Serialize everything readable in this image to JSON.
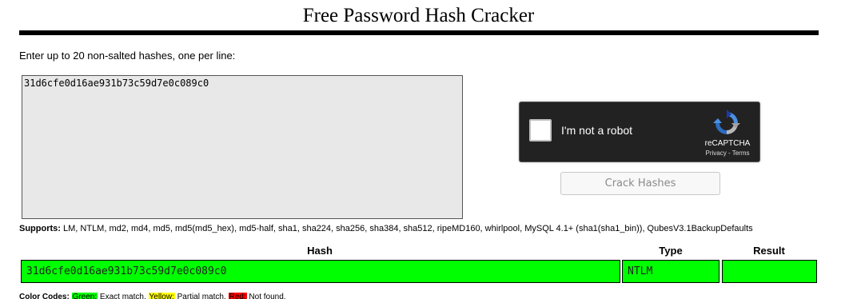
{
  "page": {
    "title": "Free Password Hash Cracker",
    "instructions": "Enter up to 20 non-salted hashes, one per line:"
  },
  "input": {
    "hashes_value": "31d6cfe0d16ae931b73c59d7e0c089c0"
  },
  "recaptcha": {
    "label": "I'm not a robot",
    "brand": "reCAPTCHA",
    "privacy_link": "Privacy",
    "separator": " - ",
    "terms_link": "Terms",
    "icon": "recaptcha-logo-icon"
  },
  "actions": {
    "crack_label": "Crack Hashes"
  },
  "supports": {
    "label": "Supports:",
    "text": " LM, NTLM, md2, md4, md5, md5(md5_hex), md5-half, sha1, sha224, sha256, sha384, sha512, ripeMD160, whirlpool, MySQL 4.1+ (sha1(sha1_bin)), QubesV3.1BackupDefaults"
  },
  "results": {
    "columns": [
      "Hash",
      "Type",
      "Result"
    ],
    "rows": [
      {
        "hash": "31d6cfe0d16ae931b73c59d7e0c089c0",
        "type": "NTLM",
        "result": "",
        "status": "exact-match"
      }
    ]
  },
  "legend": {
    "label": "Color Codes:",
    "green": "Green:",
    "green_text": " Exact match, ",
    "yellow": "Yellow:",
    "yellow_text": " Partial match, ",
    "red": "Red:",
    "red_text": " Not found."
  },
  "colors": {
    "exact_match": "#00ff00",
    "partial_match": "#ffff00",
    "not_found": "#ff0000",
    "recaptcha_bg": "#222222"
  }
}
